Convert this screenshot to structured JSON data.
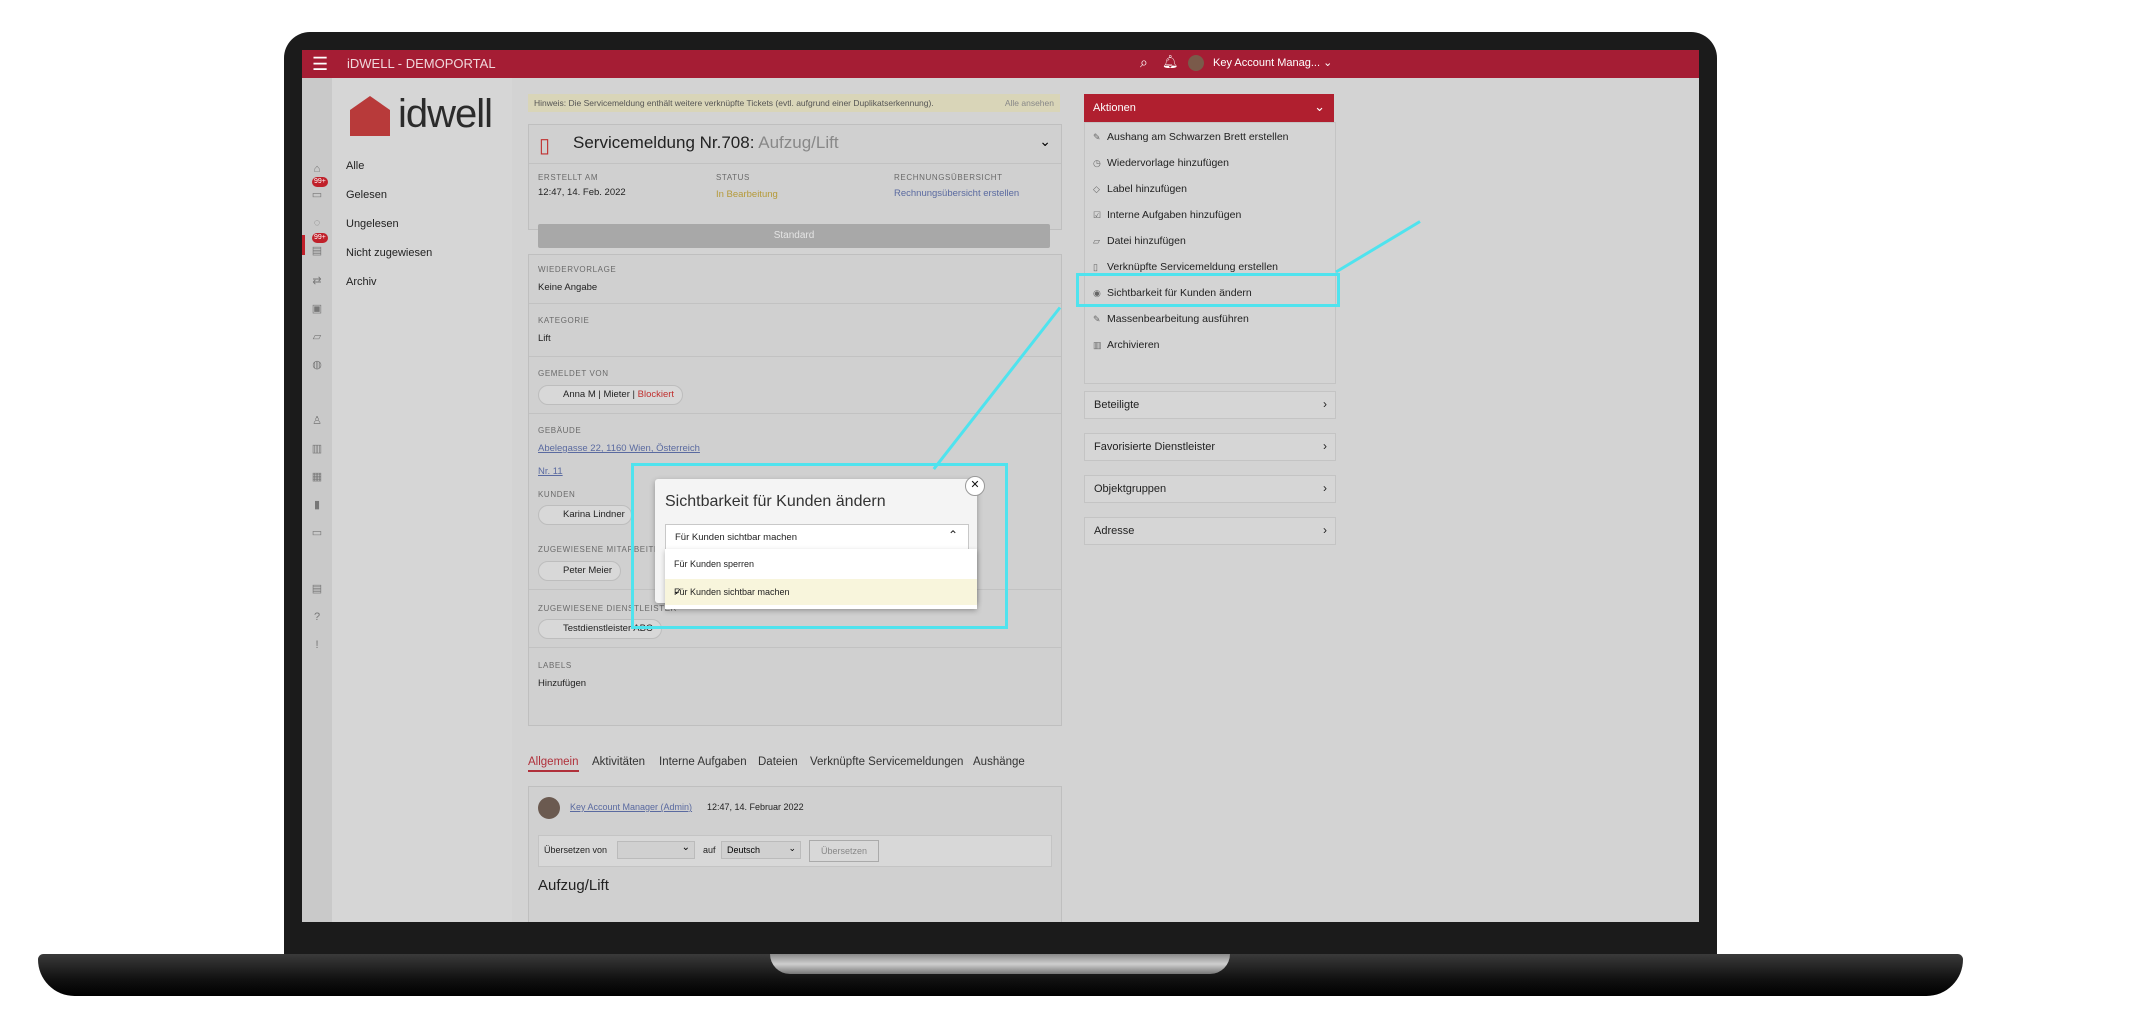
{
  "topbar": {
    "title": "iDWELL - DEMOPORTAL",
    "user_label": "Key Account Manag..."
  },
  "logo": {
    "text": "idwell"
  },
  "nav": {
    "items": [
      {
        "label": "Alle"
      },
      {
        "label": "Gelesen"
      },
      {
        "label": "Ungelesen"
      },
      {
        "label": "Nicht zugewiesen"
      },
      {
        "label": "Archiv"
      }
    ]
  },
  "badges": [
    "99+",
    "99+"
  ],
  "hint": {
    "text": "Hinweis: Die Servicemeldung enthält weitere verknüpfte Tickets (evtl. aufgrund einer Duplikatserkennung).",
    "link": "Alle ansehen"
  },
  "ticket": {
    "title_main": "Servicemeldung Nr.708:",
    "title_sub": "Aufzug/Lift",
    "created_label": "ERSTELLT AM",
    "created_value": "12:47, 14. Feb. 2022",
    "status_label": "STATUS",
    "status_value": "In Bearbeitung",
    "invoice_label": "RECHNUNGSÜBERSICHT",
    "invoice_value": "Rechnungsübersicht erstellen",
    "standard_button": "Standard",
    "followup_label": "WIEDERVORLAGE",
    "followup_value": "Keine Angabe",
    "category_label": "KATEGORIE",
    "category_value": "Lift",
    "reported_label": "GEMELDET VON",
    "reported_name": "Anna M | Mieter |",
    "reported_status": "Blockiert",
    "building_label": "GEBÄUDE",
    "building_value": "Abelegasse 22, 1160 Wien, Österreich",
    "building_unit": "Nr. 11",
    "customers_label": "KUNDEN",
    "customer_name": "Karina Lindner",
    "staff_label": "ZUGEWIESENE MITARBEITER",
    "staff_name": "Peter Meier",
    "provider_label": "ZUGEWIESENE DIENSTLEISTER",
    "provider_name": "Testdienstleister ABC",
    "labels_label": "LABELS",
    "labels_value": "Hinzufügen"
  },
  "tabs": [
    "Allgemein",
    "Aktivitäten",
    "Interne Aufgaben",
    "Dateien",
    "Verknüpfte Servicemeldungen",
    "Aushänge"
  ],
  "activity": {
    "author": "Key Account Manager (Admin)",
    "time": "12:47, 14. Februar 2022"
  },
  "translate": {
    "from_label": "Übersetzen von",
    "to_label": "auf",
    "target_lang": "Deutsch",
    "button": "Übersetzen"
  },
  "section_title": "Aufzug/Lift",
  "actions": {
    "header": "Aktionen",
    "items": [
      "Aushang am Schwarzen Brett erstellen",
      "Wiedervorlage hinzufügen",
      "Label hinzufügen",
      "Interne Aufgaben hinzufügen",
      "Datei hinzufügen",
      "Verknüpfte Servicemeldung erstellen",
      "Sichtbarkeit für Kunden ändern",
      "Massenbearbeitung ausführen",
      "Archivieren"
    ]
  },
  "panels": [
    "Beteiligte",
    "Favorisierte Dienstleister",
    "Objektgruppen",
    "Adresse"
  ],
  "modal": {
    "title": "Sichtbarkeit für Kunden ändern",
    "selected": "Für Kunden sichtbar machen",
    "options": [
      "Für Kunden sperren",
      "Für Kunden sichtbar machen"
    ]
  },
  "colors": {
    "brand": "#a51d34",
    "highlight": "#4fe3ee"
  }
}
